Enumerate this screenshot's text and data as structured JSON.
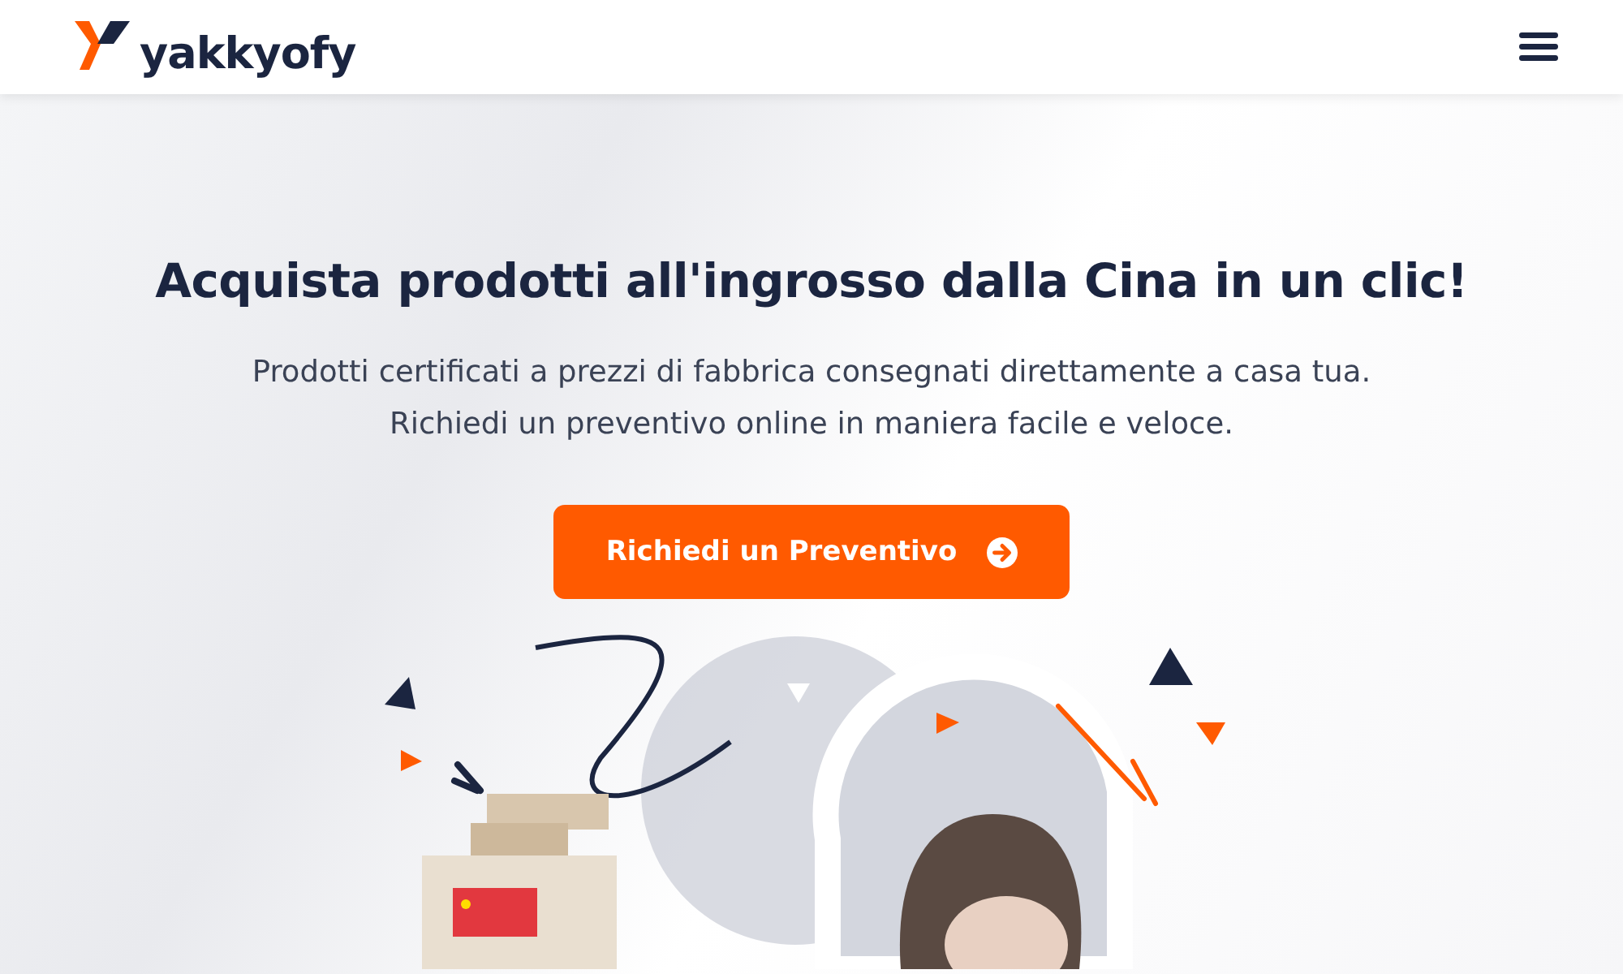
{
  "header": {
    "logo_text": "yakkyofy"
  },
  "hero": {
    "title": "Acquista prodotti all'ingrosso dalla Cina in un clic!",
    "subtitle_lines": [
      "Prodotti certificati a prezzi di fabbrica consegnati direttamente a casa tua.",
      "Richiedi un preventivo online in maniera facile e veloce."
    ],
    "cta_button": {
      "label": "Richiedi un Preventivo"
    }
  }
}
